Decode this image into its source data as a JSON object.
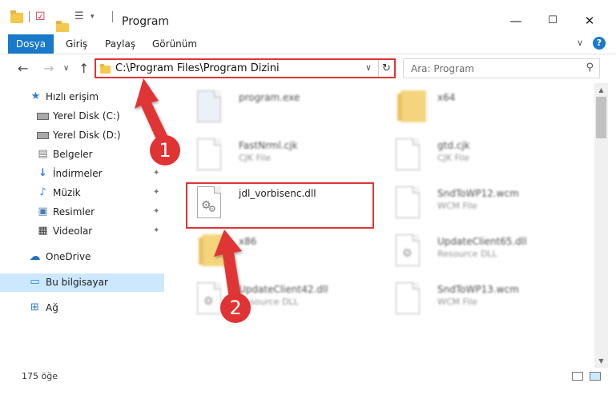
{
  "window": {
    "title": "Program",
    "min": "—",
    "max": "☐",
    "close": "✕"
  },
  "ribbon": {
    "file_tab": "Dosya",
    "tabs": [
      "Giriş",
      "Paylaş",
      "Görünüm"
    ],
    "expand": "∨",
    "help": "?"
  },
  "nav": {
    "back": "←",
    "forward": "→",
    "recent": "∨",
    "up": "↑",
    "address": "C:\\Program Files\\Program Dizini",
    "address_dropdown": "∨",
    "refresh": "↻",
    "search_placeholder": "Ara: Program",
    "search_icon": "⚲"
  },
  "sidebar": {
    "items": [
      {
        "label": "Hızlı erişim",
        "icon": "star-icon"
      },
      {
        "label": "Yerel Disk (C:)",
        "icon": "drive-icon"
      },
      {
        "label": "Yerel Disk (D:)",
        "icon": "drive-icon"
      },
      {
        "label": "Belgeler",
        "icon": "documents-icon"
      },
      {
        "label": "İndirmeler",
        "icon": "download-icon"
      },
      {
        "label": "Müzik",
        "icon": "music-icon"
      },
      {
        "label": "Resimler",
        "icon": "pictures-icon"
      },
      {
        "label": "Videolar",
        "icon": "video-icon"
      },
      {
        "label": "OneDrive",
        "icon": "cloud-icon"
      },
      {
        "label": "Bu bilgisayar",
        "icon": "computer-icon"
      },
      {
        "label": "Ağ",
        "icon": "network-icon"
      }
    ],
    "pin": "📌"
  },
  "files": [
    {
      "name": "program.exe",
      "type": "",
      "icon": "exe-icon"
    },
    {
      "name": "x64",
      "type": "",
      "icon": "folder-icon"
    },
    {
      "name": "FastNrml.cjk",
      "type": "CJK File",
      "icon": "file-icon"
    },
    {
      "name": "gtd.cjk",
      "type": "CJK File",
      "icon": "file-icon"
    },
    {
      "name": "jdl_vorbisenc.dll",
      "type": "",
      "icon": "dll-icon"
    },
    {
      "name": "SndToWP12.wcm",
      "type": "WCM File",
      "icon": "file-icon"
    },
    {
      "name": "x86",
      "type": "",
      "icon": "folder-icon"
    },
    {
      "name": "UpdateClient65.dll",
      "type": "Resource DLL",
      "icon": "dll-icon"
    },
    {
      "name": "UpdateClient42.dll",
      "type": "Resource DLL",
      "icon": "dll-icon"
    },
    {
      "name": "SndToWP13.wcm",
      "type": "WCM File",
      "icon": "file-icon"
    }
  ],
  "annotations": {
    "step1": "1",
    "step2": "2",
    "color": "#e03434"
  },
  "status": {
    "count": "175 öğe"
  },
  "colors": {
    "accent": "#1979ca",
    "selection": "#cce8ff",
    "highlight": "#e03434"
  }
}
